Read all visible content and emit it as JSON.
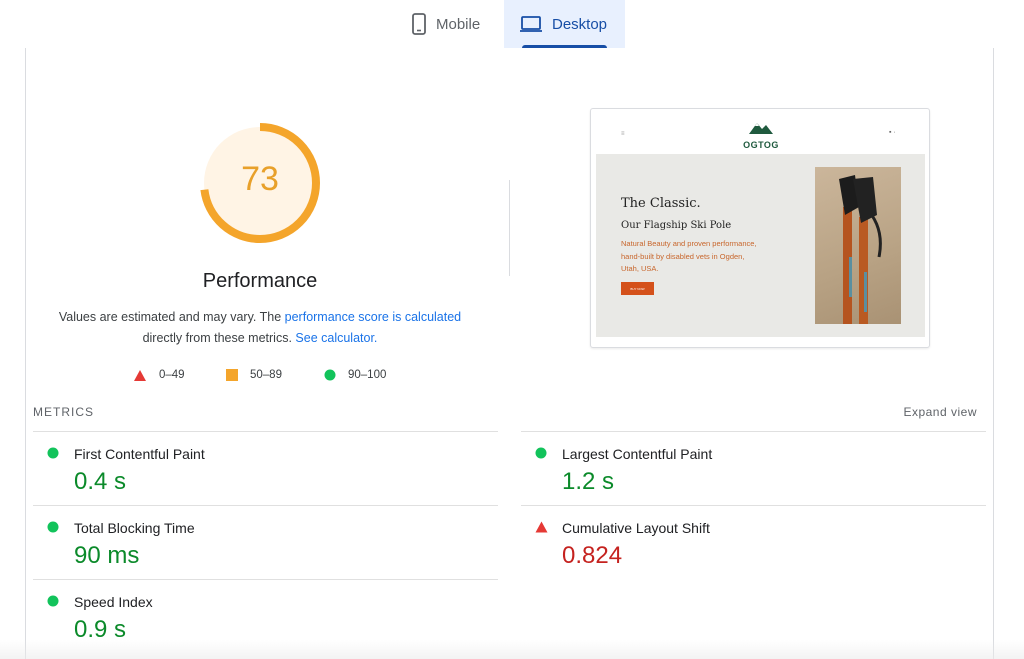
{
  "tabs": [
    {
      "label": "Mobile",
      "icon": "phone-icon"
    },
    {
      "label": "Desktop",
      "icon": "monitor-icon"
    }
  ],
  "score": {
    "value": "73",
    "fraction": 0.73,
    "label": "Performance",
    "color": "#f4a52b"
  },
  "description": {
    "text1": "Values are estimated and may vary. The ",
    "link1": "performance score is calculated",
    "text2": "directly from these metrics. ",
    "link2": "See calculator."
  },
  "legend": [
    {
      "range": "0–49",
      "shape": "triangle-icon",
      "color": "#e53935"
    },
    {
      "range": "50–89",
      "shape": "square-icon",
      "color": "#f4a52b"
    },
    {
      "range": "90–100",
      "shape": "circle-icon",
      "color": "#12c35b"
    }
  ],
  "screenshot": {
    "brand": "OGTOG",
    "hero_title": "The Classic.",
    "hero_subtitle": "Our Flagship Ski Pole",
    "hero_text": "Natural Beauty and proven performance, hand-built by disabled vets in Ogden, Utah, USA.",
    "hero_button": "BUY NOW"
  },
  "metrics_header": "METRICS",
  "expand_label": "Expand view",
  "metrics": [
    {
      "name": "First Contentful Paint",
      "value": "0.4 s",
      "status": "good"
    },
    {
      "name": "Largest Contentful Paint",
      "value": "1.2 s",
      "status": "good"
    },
    {
      "name": "Total Blocking Time",
      "value": "90 ms",
      "status": "good"
    },
    {
      "name": "Cumulative Layout Shift",
      "value": "0.824",
      "status": "poor"
    },
    {
      "name": "Speed Index",
      "value": "0.9 s",
      "status": "good"
    }
  ]
}
